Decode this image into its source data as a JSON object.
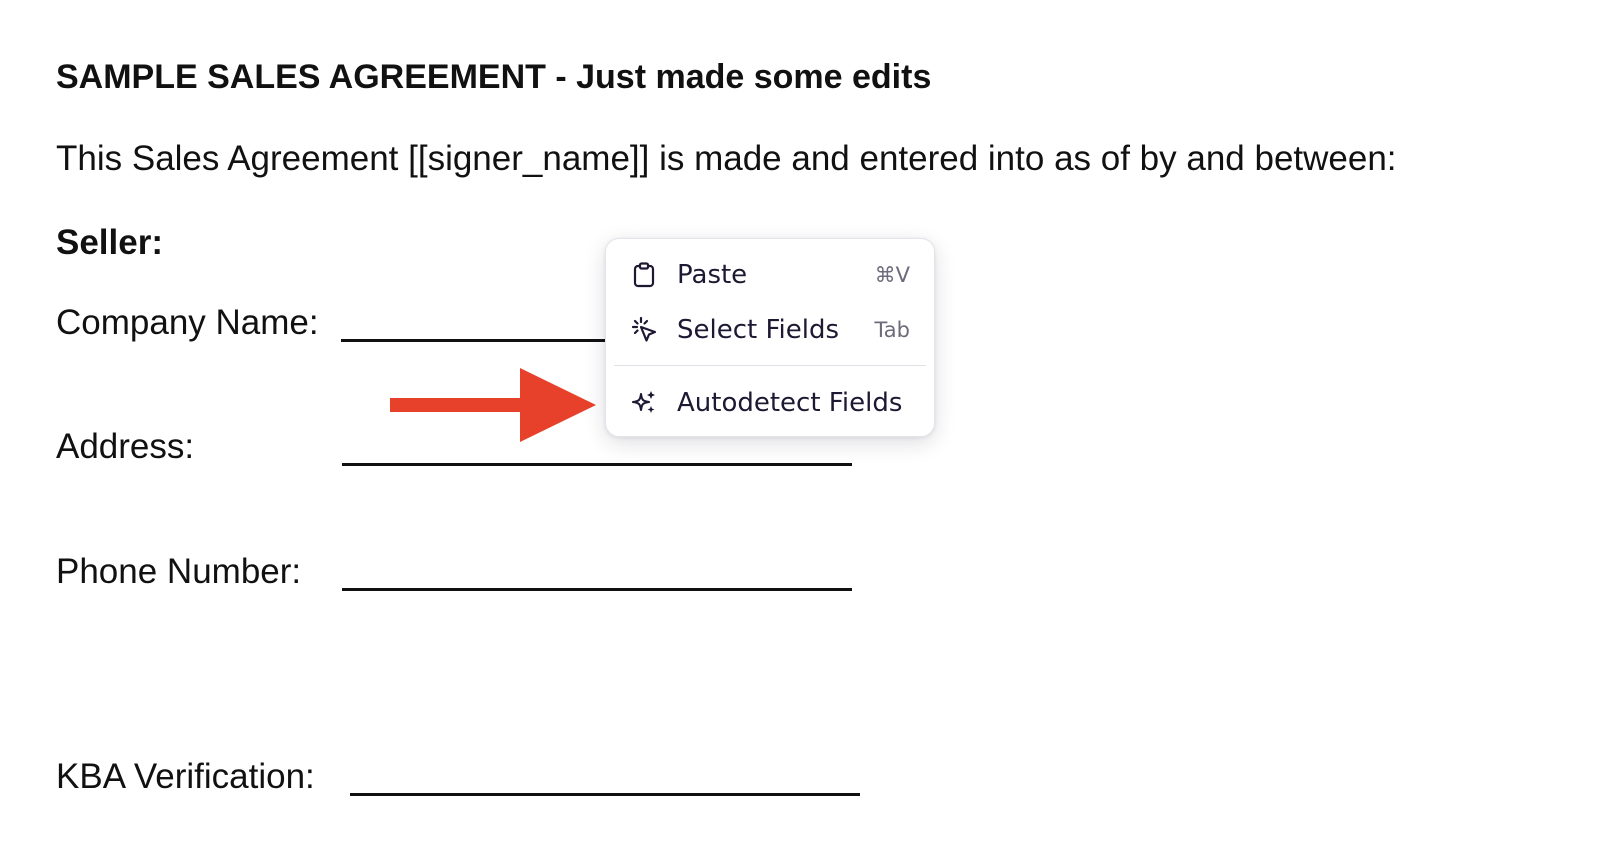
{
  "document": {
    "heading": "SAMPLE SALES AGREEMENT - Just made some edits",
    "intro": "This Sales Agreement [[signer_name]]  is made and entered into as of by and between:",
    "seller_label": "Seller:",
    "fields": {
      "company_name": "Company Name:",
      "address": "Address:",
      "phone_number": "Phone Number:",
      "kba_verification": "KBA Verification:"
    }
  },
  "context_menu": {
    "items": [
      {
        "label": "Paste",
        "shortcut": "⌘V",
        "icon": "clipboard-icon"
      },
      {
        "label": "Select Fields",
        "shortcut": "Tab",
        "icon": "click-cursor-icon"
      },
      {
        "label": "Autodetect Fields",
        "shortcut": "",
        "icon": "sparkle-icon"
      }
    ]
  },
  "colors": {
    "annotation_arrow": "#e8412b",
    "menu_text": "#1e1833",
    "document_text": "#111111"
  }
}
